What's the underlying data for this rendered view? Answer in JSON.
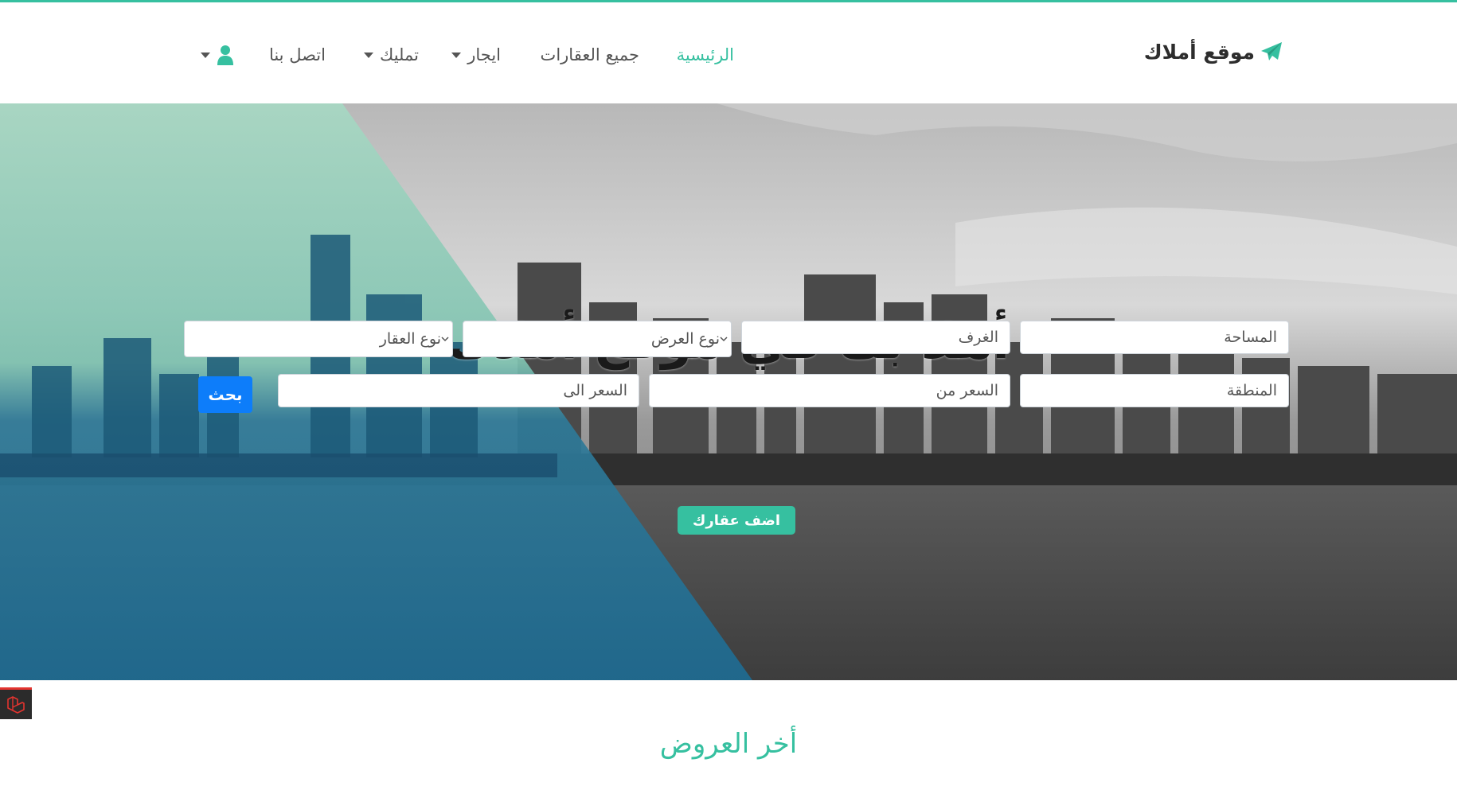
{
  "colors": {
    "accent": "#36c0a0",
    "search_button": "#0d7dfa",
    "nav_text": "#555555",
    "hero_overlay": "#3aa58b"
  },
  "navbar": {
    "brand": {
      "label": "موقع أملاك",
      "icon": "paper-plane-icon"
    },
    "items": [
      {
        "label": "الرئيسية",
        "active": true
      },
      {
        "label": "جميع العقارات",
        "active": false
      },
      {
        "label": "ايجار",
        "dropdown": true
      },
      {
        "label": "تمليك",
        "dropdown": true
      },
      {
        "label": "اتصل بنا",
        "active": false
      }
    ],
    "user_menu": {
      "icon": "user-icon",
      "dropdown": true
    }
  },
  "hero": {
    "title": "أهلا بك في موقع أملاك",
    "search": {
      "area_placeholder": "المساحة",
      "rooms_placeholder": "الغرف",
      "offer_type_label": "نوع العرض",
      "property_type_label": "نوع العقار",
      "region_placeholder": "المنطقة",
      "price_from_placeholder": "السعر من",
      "price_to_placeholder": "السعر الى",
      "search_button": "بحث"
    },
    "add_property_button": "اضف عقارك"
  },
  "latest_offers": {
    "title": "أخر العروض"
  }
}
